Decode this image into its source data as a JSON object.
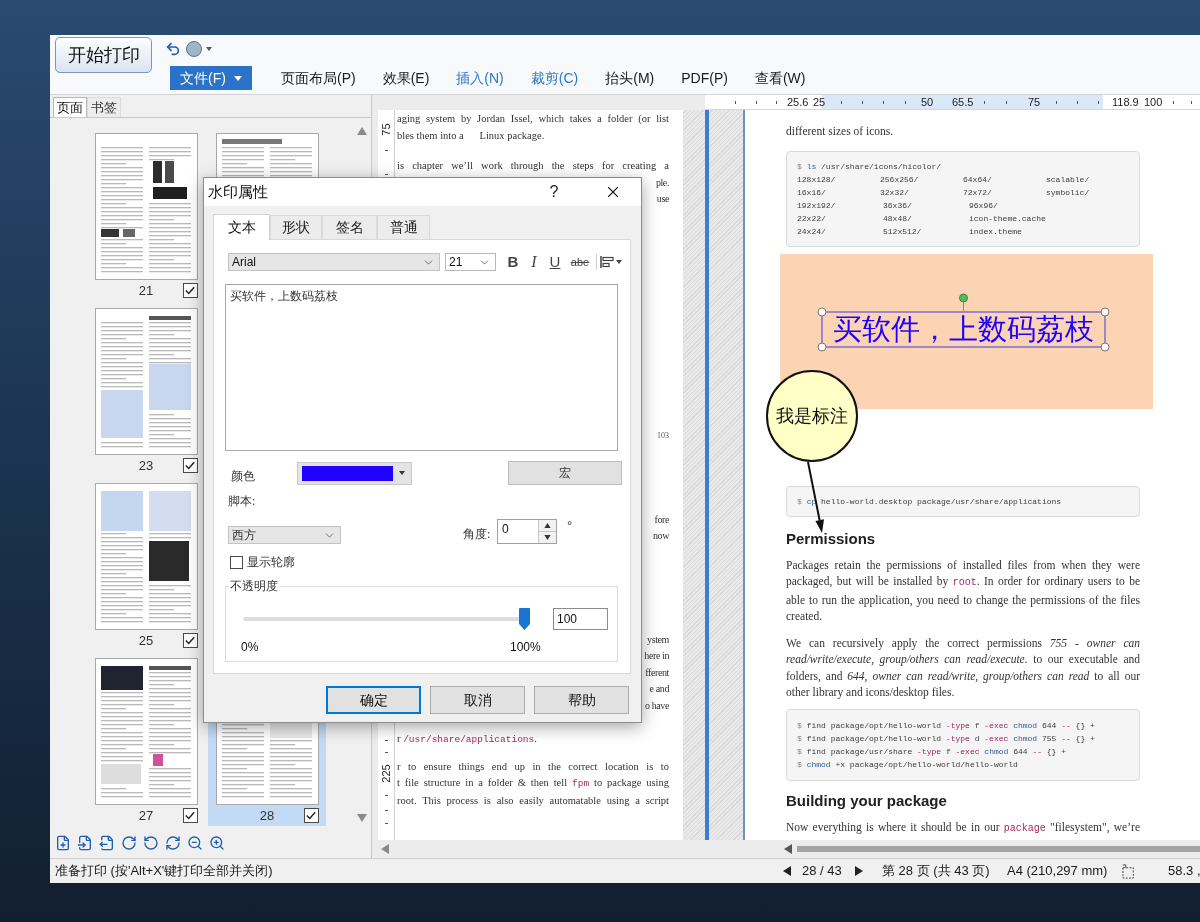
{
  "toolbar": {
    "print_button": "开始打印",
    "file_button": "文件(F)",
    "menu": [
      {
        "label": "页面布局(P)",
        "accent": false
      },
      {
        "label": "效果(E)",
        "accent": false
      },
      {
        "label": "插入(N)",
        "accent": true
      },
      {
        "label": "裁剪(C)",
        "accent": true
      },
      {
        "label": "抬头(M)",
        "accent": false
      },
      {
        "label": "PDF(P)",
        "accent": false
      },
      {
        "label": "查看(W)",
        "accent": false
      }
    ]
  },
  "sidebar": {
    "tabs": [
      {
        "label": "页面",
        "selected": true
      },
      {
        "label": "书签",
        "selected": false
      }
    ],
    "thumbnail_rows": [
      [
        {
          "kind": "page",
          "label": "21",
          "checked": true,
          "selected": false
        },
        {
          "kind": "page_top",
          "selected": false
        }
      ],
      [
        {
          "kind": "page",
          "label": "23",
          "checked": true,
          "selected": false
        }
      ],
      [
        {
          "kind": "page",
          "label": "25",
          "checked": true,
          "selected": false
        }
      ],
      [
        {
          "kind": "page",
          "label": "27",
          "checked": true,
          "selected": false
        },
        {
          "kind": "page",
          "label": "28",
          "checked": true,
          "selected": true
        }
      ]
    ]
  },
  "middle_page": {
    "ruler_labels": [
      "75",
      "225"
    ],
    "lines": [
      {
        "kind": "full_line",
        "segments": [
          {
            "kind": "text",
            "text": "aging system by Jordan Issel, which takes a folder (or list"
          }
        ]
      },
      {
        "kind": "end_line",
        "segments": [
          {
            "kind": "text",
            "text": "bles them into a      Linux package."
          }
        ]
      },
      {
        "kind": "full_line",
        "segments": [
          {
            "kind": "text",
            "text": "is chapter we’ll work through the steps for creating a"
          }
        ]
      },
      {
        "kind": "tail",
        "segments": [
          {
            "kind": "text",
            "text": "ple."
          }
        ]
      },
      {
        "kind": "tail",
        "segments": [
          {
            "kind": "text",
            "text": "use"
          }
        ]
      },
      {
        "kind": "page_number",
        "text": "103"
      },
      {
        "kind": "tail",
        "segments": [
          {
            "kind": "text",
            "text": "fore"
          }
        ]
      },
      {
        "kind": "tail",
        "segments": [
          {
            "kind": "text",
            "text": "now"
          }
        ]
      },
      {
        "kind": "tail",
        "segments": [
          {
            "kind": "text",
            "text": "ystem"
          }
        ]
      },
      {
        "kind": "tail",
        "segments": [
          {
            "kind": "text",
            "text": "here in"
          }
        ]
      },
      {
        "kind": "tail",
        "segments": [
          {
            "kind": "text",
            "text": "fferent"
          }
        ]
      },
      {
        "kind": "tail",
        "segments": [
          {
            "kind": "text",
            "text": "e and"
          }
        ]
      },
      {
        "kind": "tail",
        "segments": [
          {
            "kind": "text",
            "text": "o have"
          }
        ]
      },
      {
        "kind": "end_line",
        "segments": [
          {
            "kind": "text",
            "text": "r "
          },
          {
            "kind": "code",
            "text": "/usr/share/applications"
          },
          {
            "kind": "text",
            "text": "."
          }
        ]
      },
      {
        "kind": "full_line",
        "segments": [
          {
            "kind": "text",
            "text": "r to ensure things end up in the correct location is to"
          }
        ]
      },
      {
        "kind": "full_line",
        "segments": [
          {
            "kind": "text",
            "text": "t file structure in a folder & then tell "
          },
          {
            "kind": "code",
            "text": "fpm"
          },
          {
            "kind": "text",
            "text": " to package using"
          }
        ]
      },
      {
        "kind": "full_line",
        "segments": [
          {
            "kind": "text",
            "text": "root. This process is also easily automatable using a script"
          }
        ]
      }
    ]
  },
  "ruler": {
    "labels": [
      "25.6",
      "25",
      "50",
      "65.5",
      "75",
      "118.9",
      "100"
    ]
  },
  "right_page": {
    "intro": "different sizes of icons.",
    "ls_block": {
      "command": [
        {
          "kind": "prompt",
          "text": "$"
        },
        {
          "kind": "command",
          "text": "ls"
        },
        {
          "kind": "plain",
          "text": "/usr/share/icons/hicolor/"
        }
      ],
      "rows": [
        [
          "128x128/",
          "256x256/",
          "64x64/",
          "scalable/"
        ],
        [
          "16x16/",
          "32x32/",
          "72x72/",
          "symbolic/"
        ],
        [
          "192x192/",
          "36x36/",
          "96x96/"
        ],
        [
          "22x22/",
          "48x48/",
          "icon-theme.cache"
        ],
        [
          "24x24/",
          "512x512/",
          "index.theme"
        ]
      ]
    },
    "watermark_text": "买软件，上数码荔枝",
    "callout": "我是标注",
    "cp_block": [
      {
        "kind": "prompt",
        "text": "$"
      },
      {
        "kind": "command",
        "text": "cp"
      },
      {
        "kind": "plain",
        "text": "hello-world.desktop package/usr/share/applications"
      }
    ],
    "heading_1": "Permissions",
    "paragraph_1": [
      {
        "kind": "text",
        "text": "Packages retain the permissions of installed files from when they were packaged, but will be installed by "
      },
      {
        "kind": "code",
        "text": "root"
      },
      {
        "kind": "text",
        "text": ". In order for ordinary users to be able to run the application, you need to change the permissions of the files created."
      }
    ],
    "paragraph_2": [
      {
        "kind": "text",
        "text": "We can recursively apply the correct permissions "
      },
      {
        "kind": "italic",
        "text": "755 - owner can read/write/execute, group/others can read/execute."
      },
      {
        "kind": "text",
        "text": " to our executable and folders, and "
      },
      {
        "kind": "italic",
        "text": "644, owner can read/write, group/others can read"
      },
      {
        "kind": "text",
        "text": " to all our other library and icons/desktop files."
      }
    ],
    "find_block": [
      [
        {
          "kind": "prompt",
          "text": "$"
        },
        {
          "kind": "plain",
          "text": "find package/opt/hello-world"
        },
        {
          "kind": "keyword",
          "text": "-type"
        },
        {
          "kind": "plain",
          "text": "f"
        },
        {
          "kind": "keyword",
          "text": "-exec"
        },
        {
          "kind": "command",
          "text": "chmod"
        },
        {
          "kind": "plain",
          "text": "644"
        },
        {
          "kind": "keyword",
          "text": "--"
        },
        {
          "kind": "plain",
          "text": "{} +"
        }
      ],
      [
        {
          "kind": "prompt",
          "text": "$"
        },
        {
          "kind": "plain",
          "text": "find package/opt/hello-world"
        },
        {
          "kind": "keyword",
          "text": "-type"
        },
        {
          "kind": "plain",
          "text": "d"
        },
        {
          "kind": "keyword",
          "text": "-exec"
        },
        {
          "kind": "command",
          "text": "chmod"
        },
        {
          "kind": "plain",
          "text": "755"
        },
        {
          "kind": "keyword",
          "text": "--"
        },
        {
          "kind": "plain",
          "text": "{} +"
        }
      ],
      [
        {
          "kind": "prompt",
          "text": "$"
        },
        {
          "kind": "plain",
          "text": "find package/usr/share"
        },
        {
          "kind": "keyword",
          "text": "-type"
        },
        {
          "kind": "plain",
          "text": "f"
        },
        {
          "kind": "keyword",
          "text": "-exec"
        },
        {
          "kind": "command",
          "text": "chmod"
        },
        {
          "kind": "plain",
          "text": "644"
        },
        {
          "kind": "keyword",
          "text": "--"
        },
        {
          "kind": "plain",
          "text": "{} +"
        }
      ],
      [
        {
          "kind": "prompt",
          "text": "$"
        },
        {
          "kind": "command",
          "text": "chmod"
        },
        {
          "kind": "plain",
          "text": "+x package/opt/hello-world/hello-world"
        }
      ]
    ],
    "heading_2": "Building your package",
    "paragraph_3": [
      {
        "kind": "text",
        "text": "Now everything is where it should be in our "
      },
      {
        "kind": "code",
        "text": "package"
      },
      {
        "kind": "text",
        "text": " \"filesystem\", we’re"
      }
    ]
  },
  "dialog": {
    "title": "水印属性",
    "help_label": "?",
    "tabs": [
      {
        "label": "文本",
        "selected": true
      },
      {
        "label": "形状",
        "selected": false
      },
      {
        "label": "签名",
        "selected": false
      },
      {
        "label": "普通",
        "selected": false
      }
    ],
    "font": "Arial",
    "size": "21",
    "format_buttons": [
      {
        "kind": "bold",
        "label": "B"
      },
      {
        "kind": "italic",
        "label": "I"
      },
      {
        "kind": "underline",
        "label": "U"
      },
      {
        "kind": "strikethrough",
        "label": "abe"
      }
    ],
    "text": "买软件，上数码荔枝",
    "color_label": "颜色",
    "color": "#2000ff",
    "macro_button": "宏",
    "script_label": "脚本:",
    "script": "西方",
    "angle_label": "角度:",
    "angle": "0",
    "angle_unit": "°",
    "outline": {
      "label": "显示轮廓",
      "checked": false
    },
    "opacity": {
      "legend": "不透明度",
      "level": 1,
      "value": "100",
      "min_label": "0%",
      "max_label": "100%"
    },
    "buttons": [
      {
        "label": "确定",
        "default": true
      },
      {
        "label": "取消",
        "default": false
      },
      {
        "label": "帮助",
        "default": false
      }
    ]
  },
  "status_bar": {
    "message": "准备打印 (按'Alt+X'键打印全部并关闭)",
    "page_counter": "28 / 43",
    "page_info": "第 28 页 (共 43 页)",
    "paper_size": "A4 (210,297 mm)",
    "cursor_position": "58.3 ,"
  }
}
